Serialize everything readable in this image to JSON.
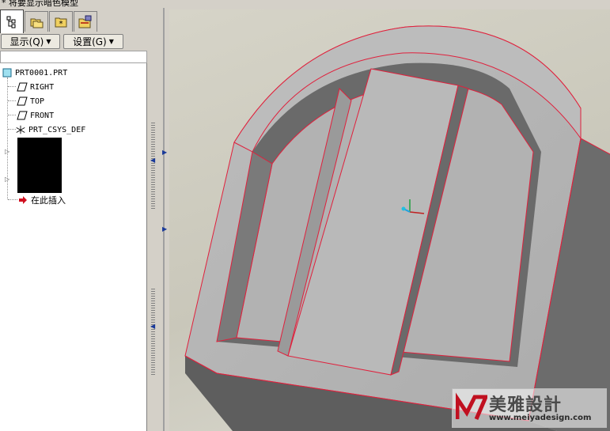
{
  "window": {
    "title": "* 将要显示暗色模型"
  },
  "tabs": [
    {
      "name": "model-tree-tab",
      "icon": "model-tree-icon"
    },
    {
      "name": "folder-browser-tab",
      "icon": "folders-icon"
    },
    {
      "name": "favorites-tab",
      "icon": "star-folder-icon"
    },
    {
      "name": "connections-tab",
      "icon": "network-folder-icon"
    }
  ],
  "toolbar": {
    "display_label": "显示(Q)",
    "settings_label": "设置(G)"
  },
  "tree": {
    "root": "PRT0001.PRT",
    "items": [
      {
        "label": "RIGHT",
        "icon": "datum-plane-icon"
      },
      {
        "label": "TOP",
        "icon": "datum-plane-icon"
      },
      {
        "label": "FRONT",
        "icon": "datum-plane-icon"
      },
      {
        "label": "PRT_CSYS_DEF",
        "icon": "csys-icon"
      }
    ],
    "insert_here": "在此插入"
  },
  "watermark": {
    "brand": "美雅設計",
    "url": "www.meiyadesign.com"
  },
  "colors": {
    "edge": "#e0203c",
    "face": "#b4b4b4",
    "shadow": "#6e6e6e",
    "background": "#d4d0c8"
  }
}
